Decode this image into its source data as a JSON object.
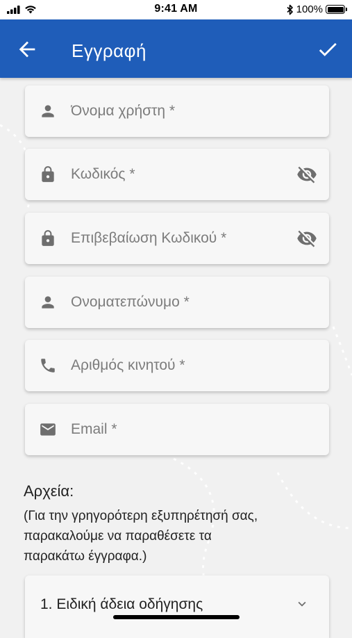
{
  "status_bar": {
    "time": "9:41 AM",
    "battery": "100%"
  },
  "app_bar": {
    "title": "Εγγραφή"
  },
  "fields": {
    "username": {
      "placeholder": "Όνομα χρήστη *",
      "icon": "person-icon"
    },
    "password": {
      "placeholder": "Κωδικός *",
      "icon": "lock-icon",
      "trailing_icon": "visibility-off-icon"
    },
    "confirm_password": {
      "placeholder": "Επιβεβαίωση Κωδικού *",
      "icon": "lock-icon",
      "trailing_icon": "visibility-off-icon"
    },
    "full_name": {
      "placeholder": "Ονοματεπώνυμο *",
      "icon": "person-icon"
    },
    "mobile": {
      "placeholder": "Αριθμός κινητού *",
      "icon": "phone-icon"
    },
    "email": {
      "placeholder": "Email *",
      "icon": "mail-icon"
    }
  },
  "files": {
    "heading": "Αρχεία:",
    "note_lines": [
      "(Για την γρηγορότερη εξυπηρέτησή σας,",
      "παρακαλούμε να παραθέσετε τα",
      "παρακάτω έγγραφα.)"
    ],
    "items": [
      {
        "label": "1. Ειδική άδεια οδήγησης"
      }
    ]
  },
  "colors": {
    "primary": "#1f5db9",
    "background": "#f1f1f1",
    "field_background": "#f7f7f7",
    "icon": "#6e6e6e"
  }
}
